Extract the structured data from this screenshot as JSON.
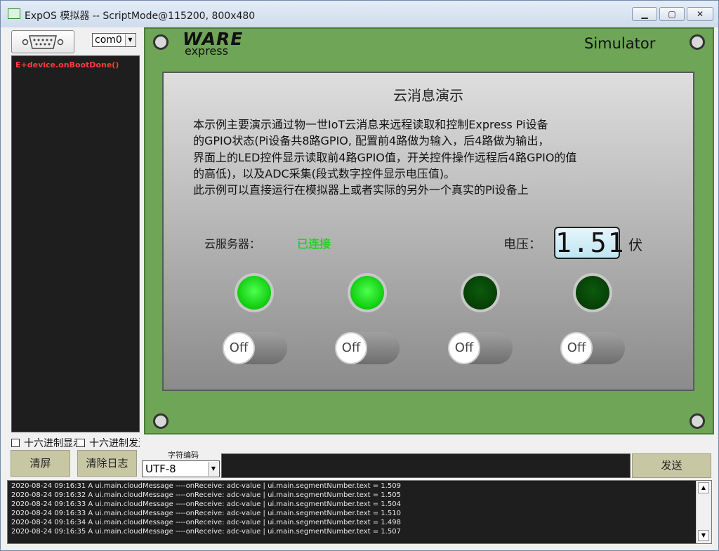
{
  "window": {
    "title": "ExpOS 模拟器 -- ScriptMode@115200, 800x480",
    "min_glyph": "▁",
    "max_glyph": "▢",
    "close_glyph": "✕"
  },
  "left_panel": {
    "port": "com0",
    "console_lines": [
      "E+device.onBootDone()"
    ],
    "hex_display_label": "十六进制显示",
    "hex_send_label": "十六进制发送",
    "clear_screen_label": "清屏",
    "clear_log_label": "清除日志"
  },
  "send_bar": {
    "encoding_label": "字符编码",
    "encoding_value": "UTF-8",
    "send_value": "",
    "send_label": "发送"
  },
  "log": {
    "lines": [
      "2020-08-24 09:16:31 A ui.main.cloudMessage ----onReceive: adc-value | ui.main.segmentNumber.text = 1.509",
      "2020-08-24 09:16:32 A ui.main.cloudMessage ----onReceive: adc-value | ui.main.segmentNumber.text = 1.505",
      "2020-08-24 09:16:33 A ui.main.cloudMessage ----onReceive: adc-value | ui.main.segmentNumber.text = 1.504",
      "2020-08-24 09:16:33 A ui.main.cloudMessage ----onReceive: adc-value | ui.main.segmentNumber.text = 1.510",
      "2020-08-24 09:16:34 A ui.main.cloudMessage ----onReceive: adc-value | ui.main.segmentNumber.text = 1.498",
      "2020-08-24 09:16:35 A ui.main.cloudMessage ----onReceive: adc-value | ui.main.segmentNumber.text = 1.507"
    ]
  },
  "simulator": {
    "logo_top": "WARE",
    "logo_bottom": "express",
    "label": "Simulator",
    "screen": {
      "heading": "云消息演示",
      "description": [
        "本示例主要演示通过物一世IoT云消息来远程读取和控制Express Pi设备",
        "的GPIO状态(Pi设备共8路GPIO, 配置前4路做为输入，后4路做为输出，",
        "界面上的LED控件显示读取前4路GPIO值，开关控件操作远程后4路GPIO的值",
        "的高低)，以及ADC采集(段式数字控件显示电压值)。",
        "此示例可以直接运行在模拟器上或者实际的另外一个真实的Pi设备上"
      ],
      "server_label": "云服务器：",
      "server_status": "已连接",
      "voltage_label": "电压：",
      "voltage_value": "1.51",
      "voltage_unit": "伏",
      "leds": [
        {
          "state": "on"
        },
        {
          "state": "on"
        },
        {
          "state": "off"
        },
        {
          "state": "off"
        }
      ],
      "switches": [
        {
          "label": "Off"
        },
        {
          "label": "Off"
        },
        {
          "label": "Off"
        },
        {
          "label": "Off"
        }
      ]
    }
  },
  "colors": {
    "board_green": "#6fa556",
    "led_on": "#18e018",
    "led_off": "#064a06",
    "status_green": "#2ecc2e",
    "button_khaki": "#c8c7a4",
    "console_bg": "#1e1e1e",
    "console_error_red": "#ff3b3b"
  },
  "icons": {
    "port": "serial-port-icon",
    "app": "app-window-icon"
  }
}
